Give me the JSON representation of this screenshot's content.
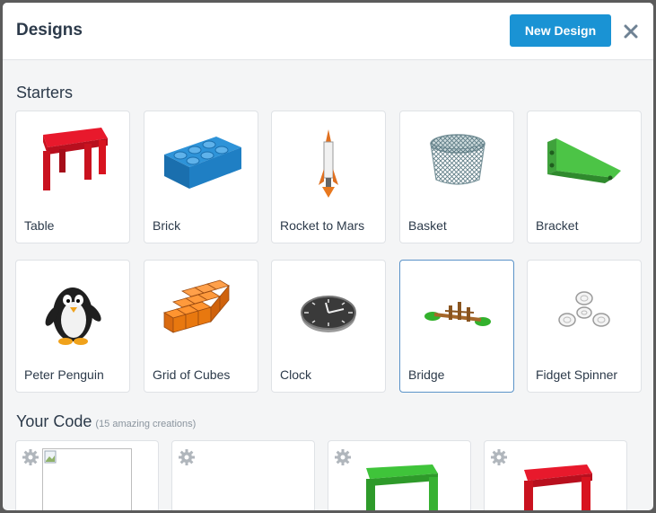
{
  "modal": {
    "title": "Designs",
    "new_design_label": "New Design",
    "close_icon": "close-icon"
  },
  "starters": {
    "heading": "Starters",
    "items": [
      {
        "label": "Table",
        "icon": "table-icon"
      },
      {
        "label": "Brick",
        "icon": "brick-icon"
      },
      {
        "label": "Rocket to Mars",
        "icon": "rocket-icon"
      },
      {
        "label": "Basket",
        "icon": "basket-icon"
      },
      {
        "label": "Bracket",
        "icon": "bracket-icon"
      },
      {
        "label": "Peter Penguin",
        "icon": "penguin-icon"
      },
      {
        "label": "Grid of Cubes",
        "icon": "cubes-icon"
      },
      {
        "label": "Clock",
        "icon": "clock-icon"
      },
      {
        "label": "Bridge",
        "icon": "bridge-icon",
        "selected": true
      },
      {
        "label": "Fidget Spinner",
        "icon": "spinner-icon"
      }
    ]
  },
  "your_code": {
    "heading": "Your Code",
    "subtitle": "(15 amazing creations)",
    "items": [
      {
        "icon": "broken-image-icon"
      },
      {
        "icon": "empty-thumbnail"
      },
      {
        "icon": "green-table-icon"
      },
      {
        "icon": "red-table-icon"
      }
    ]
  },
  "colors": {
    "accent": "#1a93d4",
    "selected_border": "#5b93c8",
    "background": "#f4f5f6"
  }
}
